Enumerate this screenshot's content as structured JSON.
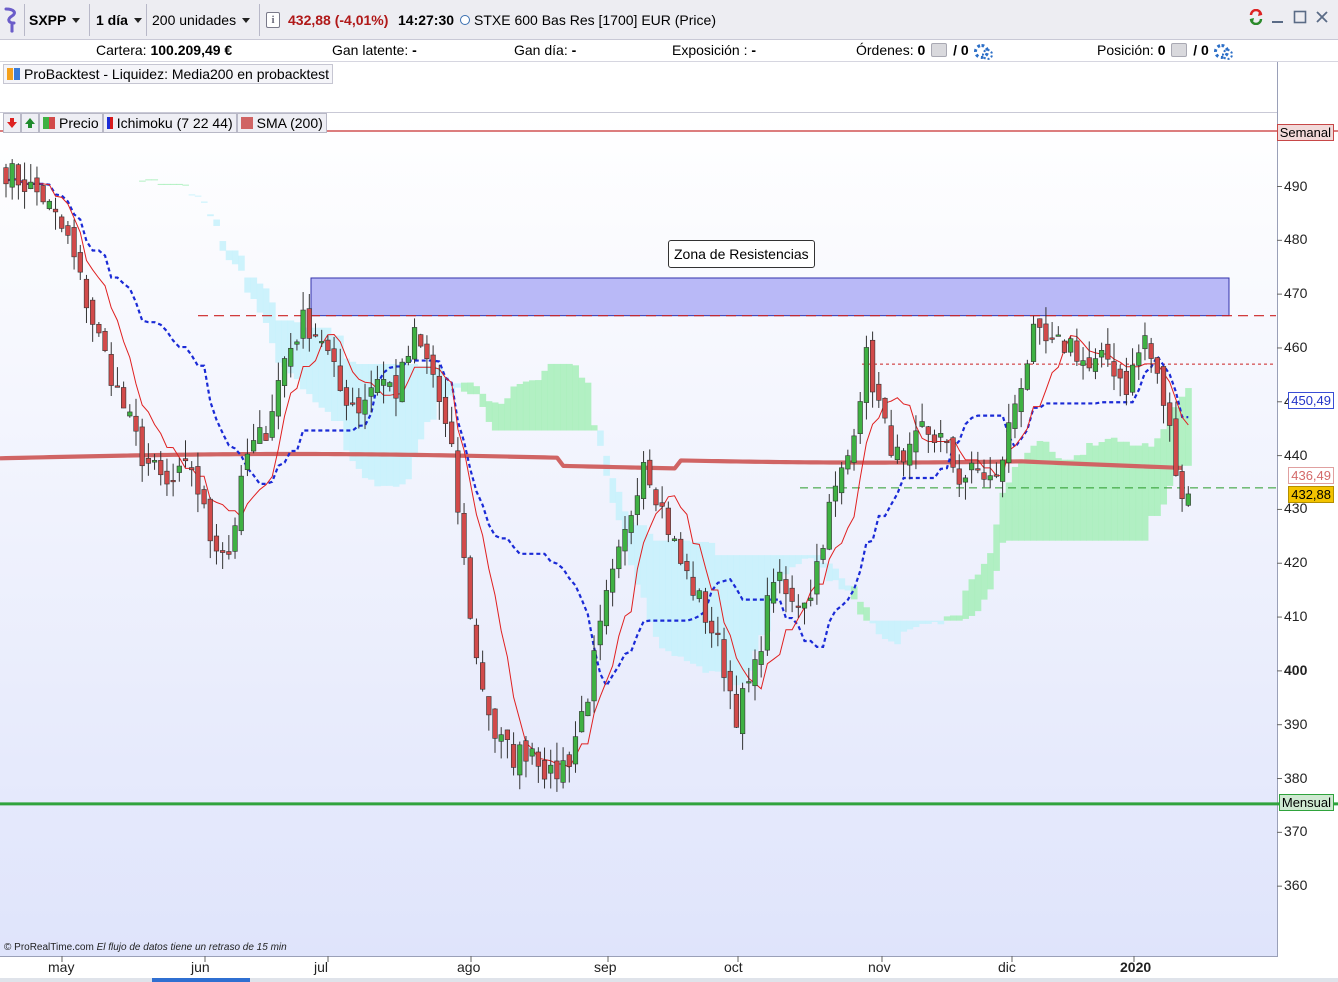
{
  "toolbar": {
    "symbol": "SXPP",
    "timeframe": "1 día",
    "units": "200 unidades",
    "info_icon": "info-icon",
    "price_change": "432,88 (-4,01%)",
    "time": "14:27:30",
    "instrument": "STXE 600 Bas Res [1700] EUR (Price)",
    "window_icons": [
      "swap-icon",
      "minimize-icon",
      "maximize-icon",
      "close-icon"
    ]
  },
  "account": {
    "cartera_label": "Cartera:",
    "cartera_value": "100.209,49 €",
    "gan_latente_label": "Gan latente:",
    "gan_latente_value": "-",
    "gan_dia_label": "Gan día:",
    "gan_dia_value": "-",
    "exposicion_label": "Exposición :",
    "exposicion_value": "-",
    "ordenes_label": "Órdenes:",
    "ordenes_value": "0",
    "ordenes_pending": "/ 0",
    "posicion_label": "Posición:",
    "posicion_value": "0",
    "posicion_pending": "/ 0"
  },
  "backtest": {
    "label": "ProBacktest - Liquidez: Media200 en probacktest"
  },
  "indicators": {
    "precio": "Precio",
    "ichimoku": "Ichimoku (7 22 44)",
    "sma": "SMA (200)"
  },
  "annotation": "Zona de Resistencias",
  "levels": {
    "weekly": "Semanal",
    "monthly": "Mensual",
    "kijun_value": "450,49",
    "sma_value": "436,49",
    "last_price": "432,88"
  },
  "footer": {
    "brand": "© ProRealTime.com",
    "note": "El flujo de datos tiene un retraso de 15 min"
  },
  "colors": {
    "bull": "#3fb143",
    "bear": "#d24a4a",
    "kijun": "#1a2ad6",
    "tenkan": "#e02020",
    "sma": "#d06464",
    "kumo_bull": "#a6efb8",
    "kumo_bear": "#c6f1fb",
    "resistance_zone": "#b9b9f7",
    "weekly_line": "#c73030",
    "monthly_line": "#2fa33c",
    "last_price_tag": "#f3c300"
  },
  "chart_data": {
    "type": "candlestick",
    "title": "",
    "y_ticks": [
      490,
      480,
      470,
      460,
      450,
      440,
      430,
      420,
      410,
      400,
      390,
      380,
      370,
      360
    ],
    "y_range": [
      350,
      497
    ],
    "x_labels": [
      "may",
      "jun",
      "jul",
      "ago",
      "sep",
      "oct",
      "nov",
      "dic",
      "2020"
    ],
    "resistance_zone": [
      466,
      473
    ],
    "resistance_line": 466,
    "weekly_level": 490.2,
    "monthly_level": 375.3,
    "support_level": 457,
    "last_price_level": 434,
    "last_price": 432.88,
    "kijun_last": 450.49,
    "sma_last": 436.49,
    "anchors": [
      [
        0,
        493
      ],
      [
        6,
        488
      ],
      [
        10,
        480
      ],
      [
        14,
        465
      ],
      [
        18,
        452
      ],
      [
        22,
        440
      ],
      [
        26,
        434
      ],
      [
        30,
        438
      ],
      [
        33,
        425
      ],
      [
        36,
        422
      ],
      [
        39,
        440
      ],
      [
        42,
        445
      ],
      [
        45,
        458
      ],
      [
        48,
        465
      ],
      [
        51,
        462
      ],
      [
        54,
        452
      ],
      [
        57,
        449
      ],
      [
        60,
        455
      ],
      [
        63,
        452
      ],
      [
        66,
        462
      ],
      [
        69,
        455
      ],
      [
        72,
        440
      ],
      [
        74,
        420
      ],
      [
        76,
        402
      ],
      [
        79,
        388
      ],
      [
        82,
        384
      ],
      [
        85,
        386
      ],
      [
        88,
        380
      ],
      [
        91,
        384
      ],
      [
        94,
        396
      ],
      [
        97,
        413
      ],
      [
        100,
        425
      ],
      [
        103,
        440
      ],
      [
        106,
        430
      ],
      [
        109,
        420
      ],
      [
        112,
        413
      ],
      [
        115,
        405
      ],
      [
        118,
        392
      ],
      [
        121,
        400
      ],
      [
        124,
        418
      ],
      [
        127,
        412
      ],
      [
        130,
        415
      ],
      [
        133,
        430
      ],
      [
        136,
        440
      ],
      [
        139,
        458
      ],
      [
        142,
        445
      ],
      [
        145,
        437
      ],
      [
        148,
        445
      ],
      [
        151,
        443
      ],
      [
        154,
        436
      ],
      [
        157,
        437
      ],
      [
        160,
        435
      ],
      [
        163,
        450
      ],
      [
        166,
        462
      ],
      [
        169,
        460
      ],
      [
        172,
        461
      ],
      [
        175,
        456
      ],
      [
        178,
        458
      ],
      [
        181,
        453
      ],
      [
        184,
        462
      ],
      [
        187,
        450
      ],
      [
        190,
        433
      ]
    ]
  }
}
